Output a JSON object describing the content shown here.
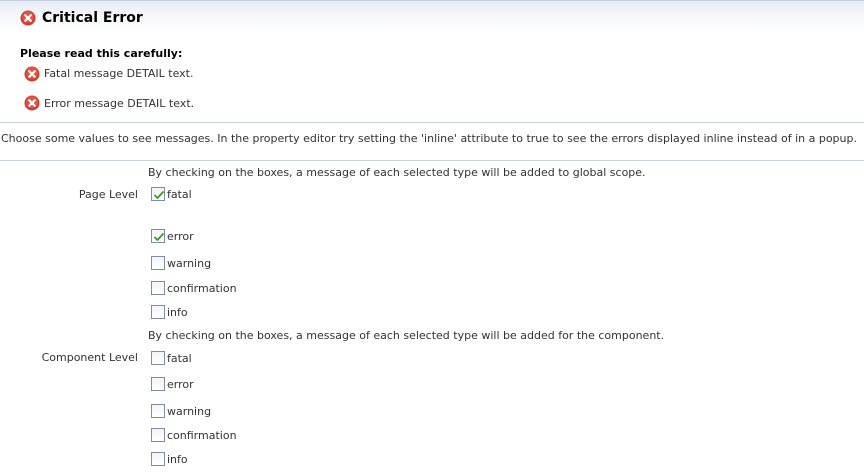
{
  "message_panel": {
    "title": "Critical Error",
    "header": "Please read this carefully:",
    "messages": [
      "Fatal message DETAIL text.",
      "Error message DETAIL text."
    ]
  },
  "instructions": "Choose some values to see messages. In the property editor try setting the 'inline' attribute to true to see the errors displayed inline instead of in a popup.",
  "page_level": {
    "label": "Page Level",
    "description": "By checking on the boxes, a message of each selected type will be added to global scope.",
    "options": [
      {
        "label": "fatal",
        "checked": true
      },
      {
        "label": "error",
        "checked": true
      },
      {
        "label": "warning",
        "checked": false
      },
      {
        "label": "confirmation",
        "checked": false
      },
      {
        "label": "info",
        "checked": false
      }
    ]
  },
  "component_level": {
    "label": "Component Level",
    "description": "By checking on the boxes, a message of each selected type will be added for the component.",
    "options": [
      {
        "label": "fatal",
        "checked": false
      },
      {
        "label": "error",
        "checked": false
      },
      {
        "label": "warning",
        "checked": false
      },
      {
        "label": "confirmation",
        "checked": false
      },
      {
        "label": "info",
        "checked": false
      }
    ]
  },
  "colors": {
    "error_icon": "#d9382b",
    "check_mark": "#3a9a22",
    "checkbox_border": "#7f8ea5"
  },
  "icons": {
    "title": "error-icon",
    "message": "error-icon",
    "checkbox": "check-icon"
  }
}
